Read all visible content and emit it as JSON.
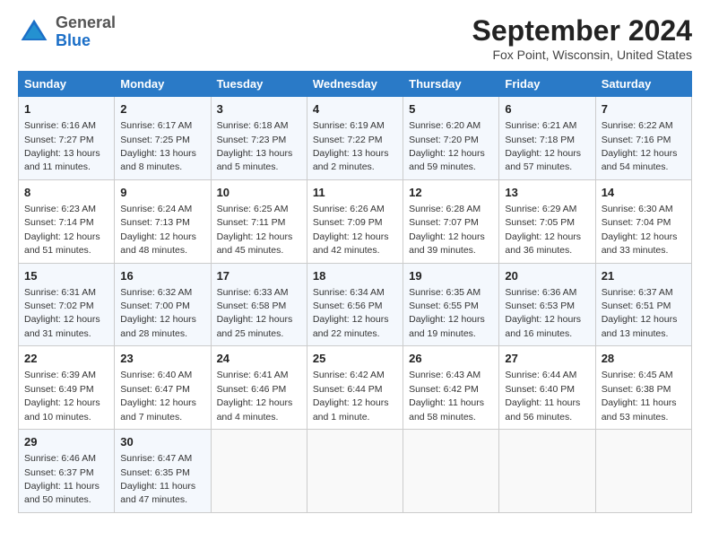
{
  "header": {
    "logo": {
      "general": "General",
      "blue": "Blue"
    },
    "title": "September 2024",
    "location": "Fox Point, Wisconsin, United States"
  },
  "columns": [
    "Sunday",
    "Monday",
    "Tuesday",
    "Wednesday",
    "Thursday",
    "Friday",
    "Saturday"
  ],
  "weeks": [
    [
      {
        "day": "1",
        "sunrise": "Sunrise: 6:16 AM",
        "sunset": "Sunset: 7:27 PM",
        "daylight": "Daylight: 13 hours and 11 minutes."
      },
      {
        "day": "2",
        "sunrise": "Sunrise: 6:17 AM",
        "sunset": "Sunset: 7:25 PM",
        "daylight": "Daylight: 13 hours and 8 minutes."
      },
      {
        "day": "3",
        "sunrise": "Sunrise: 6:18 AM",
        "sunset": "Sunset: 7:23 PM",
        "daylight": "Daylight: 13 hours and 5 minutes."
      },
      {
        "day": "4",
        "sunrise": "Sunrise: 6:19 AM",
        "sunset": "Sunset: 7:22 PM",
        "daylight": "Daylight: 13 hours and 2 minutes."
      },
      {
        "day": "5",
        "sunrise": "Sunrise: 6:20 AM",
        "sunset": "Sunset: 7:20 PM",
        "daylight": "Daylight: 12 hours and 59 minutes."
      },
      {
        "day": "6",
        "sunrise": "Sunrise: 6:21 AM",
        "sunset": "Sunset: 7:18 PM",
        "daylight": "Daylight: 12 hours and 57 minutes."
      },
      {
        "day": "7",
        "sunrise": "Sunrise: 6:22 AM",
        "sunset": "Sunset: 7:16 PM",
        "daylight": "Daylight: 12 hours and 54 minutes."
      }
    ],
    [
      {
        "day": "8",
        "sunrise": "Sunrise: 6:23 AM",
        "sunset": "Sunset: 7:14 PM",
        "daylight": "Daylight: 12 hours and 51 minutes."
      },
      {
        "day": "9",
        "sunrise": "Sunrise: 6:24 AM",
        "sunset": "Sunset: 7:13 PM",
        "daylight": "Daylight: 12 hours and 48 minutes."
      },
      {
        "day": "10",
        "sunrise": "Sunrise: 6:25 AM",
        "sunset": "Sunset: 7:11 PM",
        "daylight": "Daylight: 12 hours and 45 minutes."
      },
      {
        "day": "11",
        "sunrise": "Sunrise: 6:26 AM",
        "sunset": "Sunset: 7:09 PM",
        "daylight": "Daylight: 12 hours and 42 minutes."
      },
      {
        "day": "12",
        "sunrise": "Sunrise: 6:28 AM",
        "sunset": "Sunset: 7:07 PM",
        "daylight": "Daylight: 12 hours and 39 minutes."
      },
      {
        "day": "13",
        "sunrise": "Sunrise: 6:29 AM",
        "sunset": "Sunset: 7:05 PM",
        "daylight": "Daylight: 12 hours and 36 minutes."
      },
      {
        "day": "14",
        "sunrise": "Sunrise: 6:30 AM",
        "sunset": "Sunset: 7:04 PM",
        "daylight": "Daylight: 12 hours and 33 minutes."
      }
    ],
    [
      {
        "day": "15",
        "sunrise": "Sunrise: 6:31 AM",
        "sunset": "Sunset: 7:02 PM",
        "daylight": "Daylight: 12 hours and 31 minutes."
      },
      {
        "day": "16",
        "sunrise": "Sunrise: 6:32 AM",
        "sunset": "Sunset: 7:00 PM",
        "daylight": "Daylight: 12 hours and 28 minutes."
      },
      {
        "day": "17",
        "sunrise": "Sunrise: 6:33 AM",
        "sunset": "Sunset: 6:58 PM",
        "daylight": "Daylight: 12 hours and 25 minutes."
      },
      {
        "day": "18",
        "sunrise": "Sunrise: 6:34 AM",
        "sunset": "Sunset: 6:56 PM",
        "daylight": "Daylight: 12 hours and 22 minutes."
      },
      {
        "day": "19",
        "sunrise": "Sunrise: 6:35 AM",
        "sunset": "Sunset: 6:55 PM",
        "daylight": "Daylight: 12 hours and 19 minutes."
      },
      {
        "day": "20",
        "sunrise": "Sunrise: 6:36 AM",
        "sunset": "Sunset: 6:53 PM",
        "daylight": "Daylight: 12 hours and 16 minutes."
      },
      {
        "day": "21",
        "sunrise": "Sunrise: 6:37 AM",
        "sunset": "Sunset: 6:51 PM",
        "daylight": "Daylight: 12 hours and 13 minutes."
      }
    ],
    [
      {
        "day": "22",
        "sunrise": "Sunrise: 6:39 AM",
        "sunset": "Sunset: 6:49 PM",
        "daylight": "Daylight: 12 hours and 10 minutes."
      },
      {
        "day": "23",
        "sunrise": "Sunrise: 6:40 AM",
        "sunset": "Sunset: 6:47 PM",
        "daylight": "Daylight: 12 hours and 7 minutes."
      },
      {
        "day": "24",
        "sunrise": "Sunrise: 6:41 AM",
        "sunset": "Sunset: 6:46 PM",
        "daylight": "Daylight: 12 hours and 4 minutes."
      },
      {
        "day": "25",
        "sunrise": "Sunrise: 6:42 AM",
        "sunset": "Sunset: 6:44 PM",
        "daylight": "Daylight: 12 hours and 1 minute."
      },
      {
        "day": "26",
        "sunrise": "Sunrise: 6:43 AM",
        "sunset": "Sunset: 6:42 PM",
        "daylight": "Daylight: 11 hours and 58 minutes."
      },
      {
        "day": "27",
        "sunrise": "Sunrise: 6:44 AM",
        "sunset": "Sunset: 6:40 PM",
        "daylight": "Daylight: 11 hours and 56 minutes."
      },
      {
        "day": "28",
        "sunrise": "Sunrise: 6:45 AM",
        "sunset": "Sunset: 6:38 PM",
        "daylight": "Daylight: 11 hours and 53 minutes."
      }
    ],
    [
      {
        "day": "29",
        "sunrise": "Sunrise: 6:46 AM",
        "sunset": "Sunset: 6:37 PM",
        "daylight": "Daylight: 11 hours and 50 minutes."
      },
      {
        "day": "30",
        "sunrise": "Sunrise: 6:47 AM",
        "sunset": "Sunset: 6:35 PM",
        "daylight": "Daylight: 11 hours and 47 minutes."
      },
      null,
      null,
      null,
      null,
      null
    ]
  ]
}
